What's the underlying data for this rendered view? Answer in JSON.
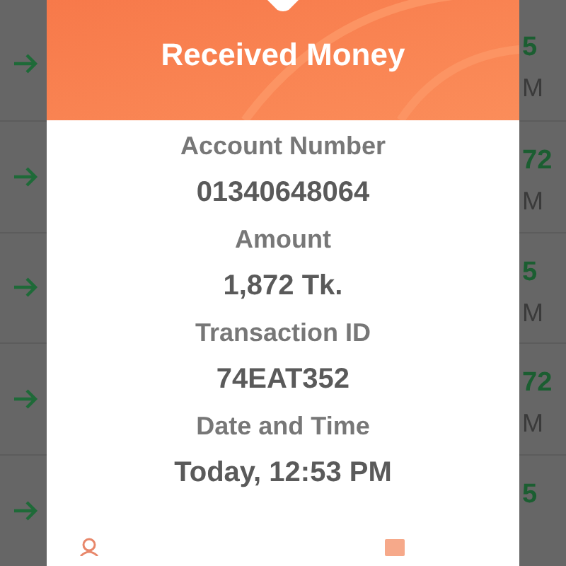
{
  "background_rows": [
    {
      "amount": "5",
      "time": "M"
    },
    {
      "amount": "72",
      "time": "M"
    },
    {
      "amount": "5",
      "time": "M"
    },
    {
      "amount": "72",
      "time": "M"
    },
    {
      "amount": "5"
    }
  ],
  "dialog": {
    "title": "Received Money",
    "fields": [
      {
        "label": "Account Number",
        "value": "01340648064"
      },
      {
        "label": "Amount",
        "value": "1,872 Tk."
      },
      {
        "label": "Transaction ID",
        "value": "74EAT352"
      },
      {
        "label": "Date and Time",
        "value": "Today, 12:53 PM"
      }
    ]
  }
}
